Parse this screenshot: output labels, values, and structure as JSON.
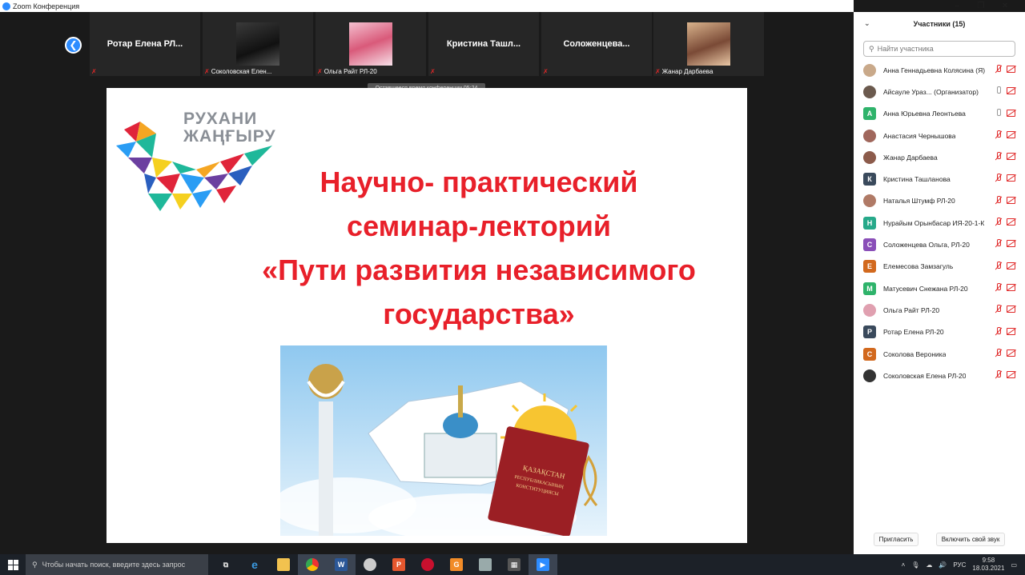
{
  "window": {
    "title": "Zoom Конференция",
    "controls": [
      "–",
      "❐",
      "✕"
    ]
  },
  "gallery": {
    "tiles": [
      {
        "name": "Ротар  Елена  РЛ...",
        "label": ""
      },
      {
        "name": "",
        "label": "Соколовская Елен..."
      },
      {
        "name": "",
        "label": "Ольга Райт РЛ-20"
      },
      {
        "name": "Кристина  Ташл...",
        "label": ""
      },
      {
        "name": "Соложенцева...",
        "label": ""
      },
      {
        "name": "",
        "label": "Жанар Дарбаева"
      }
    ],
    "timer": "Оставшееся время конференции 05:24"
  },
  "slide": {
    "logo_line1": "РУХАНИ",
    "logo_line2": "ЖАҢҒЫРУ",
    "heading_lines": [
      "Научно- практический",
      "семинар-лекторий",
      "«Пути развития независимого",
      "государства»"
    ],
    "book_text_1": "ҚАЗАҚСТАН",
    "book_text_2": "РЕСПУБЛИКАСЫНЫҢ",
    "book_text_3": "КОНСТИТУЦИЯСЫ"
  },
  "participants": {
    "title": "Участники (15)",
    "search_placeholder": "Найти участника",
    "list": [
      {
        "name": "Анна Геннадьевна Колясина (Я)",
        "initial": "",
        "color": "#c9a98a",
        "mic": "off"
      },
      {
        "name": "Айсауле Ураз... (Организатор)",
        "initial": "",
        "color": "#6b5a4e",
        "mic": "on"
      },
      {
        "name": "Анна Юрьевна Леонтьева",
        "initial": "А",
        "color": "#2fb36b",
        "mic": "on"
      },
      {
        "name": "Анастасия Чернышова",
        "initial": "",
        "color": "#a0675c",
        "mic": "off"
      },
      {
        "name": "Жанар Дарбаева",
        "initial": "",
        "color": "#8c5b4b",
        "mic": "off"
      },
      {
        "name": "Кристина Ташланова",
        "initial": "К",
        "color": "#3a4a5c",
        "mic": "off"
      },
      {
        "name": "Наталья Штумф РЛ-20",
        "initial": "",
        "color": "#b07a66",
        "mic": "off"
      },
      {
        "name": "Нурайым Орынбасар ИЯ-20-1-К",
        "initial": "Н",
        "color": "#27a98a",
        "mic": "off"
      },
      {
        "name": "Соложенцева Ольга, РЛ-20",
        "initial": "С",
        "color": "#8a4fb8",
        "mic": "off"
      },
      {
        "name": "Елемесова Замзагуль",
        "initial": "Е",
        "color": "#d2691e",
        "mic": "off"
      },
      {
        "name": "Матусевич Снежана РЛ-20",
        "initial": "М",
        "color": "#2fb36b",
        "mic": "off"
      },
      {
        "name": "Ольга Райт РЛ-20",
        "initial": "",
        "color": "#e0a0b0",
        "mic": "off"
      },
      {
        "name": "Ротар Елена РЛ-20",
        "initial": "Р",
        "color": "#3a4a5c",
        "mic": "off"
      },
      {
        "name": "Соколова Вероника",
        "initial": "С",
        "color": "#d2691e",
        "mic": "off"
      },
      {
        "name": "Соколовская Елена РЛ-20",
        "initial": "",
        "color": "#333333",
        "mic": "off"
      }
    ],
    "invite_label": "Пригласить",
    "unmute_label": "Включить свой звук"
  },
  "taskbar": {
    "search_placeholder": "Чтобы начать поиск, введите здесь запрос",
    "language": "РУС",
    "time": "9:58",
    "date": "18.03.2021"
  }
}
